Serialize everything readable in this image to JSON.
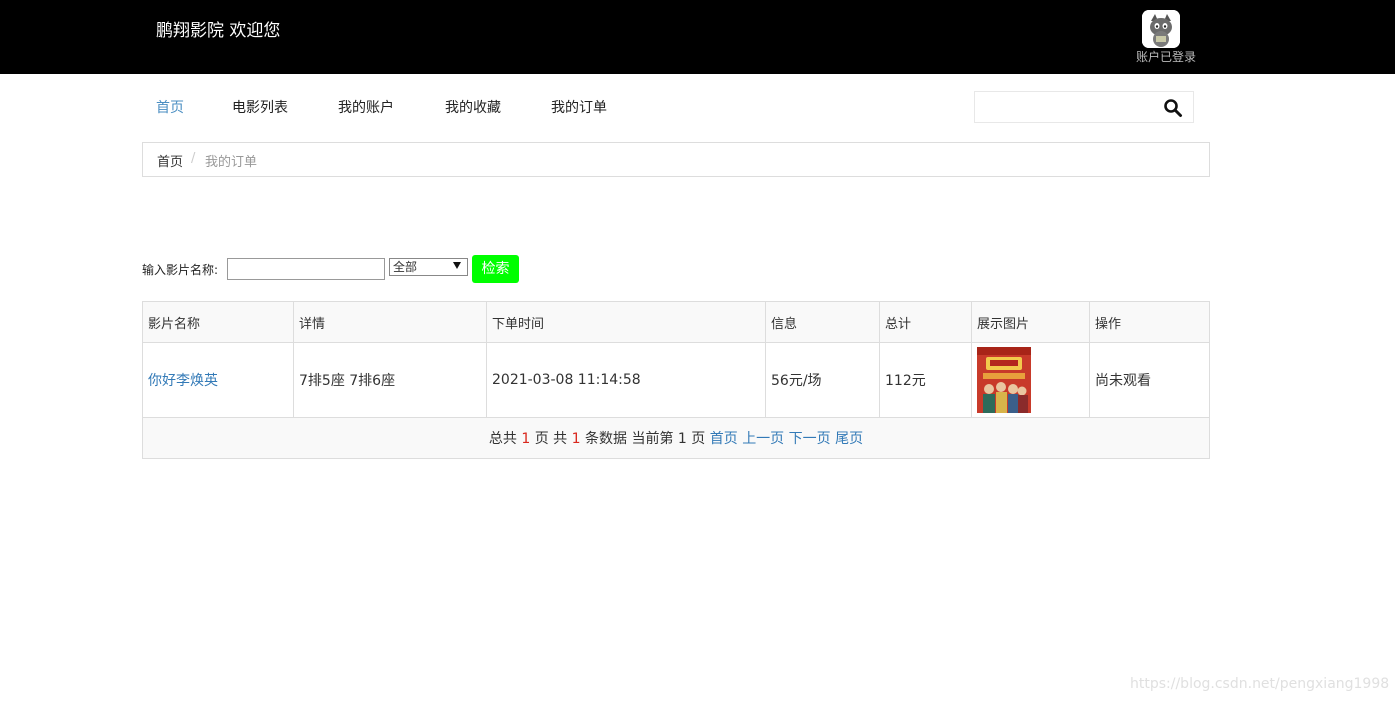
{
  "header": {
    "brand": "鹏翔影院 欢迎您",
    "login_status": "账户已登录"
  },
  "nav": {
    "items": [
      "首页",
      "电影列表",
      "我的账户",
      "我的收藏",
      "我的订单"
    ],
    "active": "首页"
  },
  "breadcrumb": {
    "home": "首页",
    "separator": "/",
    "current": "我的订单"
  },
  "filter": {
    "label": "输入影片名称:",
    "input_value": "",
    "select_value": "全部",
    "search_button": "检索",
    "button_color": "#00ff00"
  },
  "table": {
    "headers": [
      "影片名称",
      "详情",
      "下单时间",
      "信息",
      "总计",
      "展示图片",
      "操作"
    ],
    "rows": [
      {
        "title": "你好李焕英",
        "details": "7排5座 7排6座",
        "order_time": "2021-03-08 11:14:58",
        "info": "56元/场",
        "total": "112元",
        "poster": "poster-image",
        "action": "尚未观看"
      }
    ]
  },
  "pager": {
    "total_pages_prefix": "总共",
    "total_pages": "1",
    "pages_unit": "页 共",
    "total_records": "1",
    "records_unit": "条数据 当前第 1 页",
    "first": "首页",
    "prev": "上一页",
    "next": "下一页",
    "last": "尾页"
  },
  "watermark": "https://blog.csdn.net/pengxiang1998",
  "colors": {
    "header_bg": "#000000",
    "link": "#337ab7",
    "active_nav": "#4a8ec2",
    "count_red": "#d9281e"
  }
}
